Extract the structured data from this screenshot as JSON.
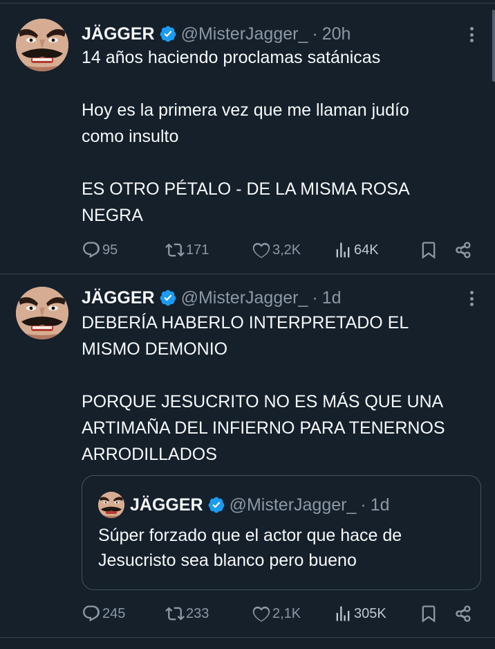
{
  "tweets": [
    {
      "author_name": "JÄGGER",
      "handle": "@MisterJagger_",
      "separator": "·",
      "time": "20h",
      "text_blocks": [
        "14 años haciendo proclamas satánicas",
        "Hoy es la primera vez que me llaman judío\ncomo insulto",
        "ES OTRO PÉTALO - DE LA MISMA ROSA\nNEGRA"
      ],
      "replies": "95",
      "retweets": "171",
      "likes": "3,2K",
      "views": "64K"
    },
    {
      "author_name": "JÄGGER",
      "handle": "@MisterJagger_",
      "separator": "·",
      "time": "1d",
      "text_blocks": [
        "DEBERÍA HABERLO INTERPRETADO EL\nMISMO DEMONIO",
        "PORQUE JESUCRITO NO ES MÁS QUE UNA\nARTIMAÑA DEL INFIERNO PARA TENERNOS\nARRODILLADOS"
      ],
      "quote": {
        "author_name": "JÄGGER",
        "handle": "@MisterJagger_",
        "separator": "·",
        "time": "1d",
        "text": "Súper forzado que el actor que hace de\nJesucristo sea blanco pero bueno"
      },
      "replies": "245",
      "retweets": "233",
      "likes": "2,1K",
      "views": "305K"
    }
  ],
  "icons": {
    "verified": "verified-badge-icon",
    "more": "more-options-icon",
    "reply": "reply-icon",
    "retweet": "retweet-icon",
    "like": "heart-icon",
    "views": "views-chart-icon",
    "bookmark": "bookmark-icon",
    "share": "share-icon"
  },
  "colors": {
    "background": "#15202b",
    "text": "#f7f9f9",
    "secondary_text": "#8b98a5",
    "verified_blue": "#1d9bf0",
    "divider": "#38444d"
  }
}
